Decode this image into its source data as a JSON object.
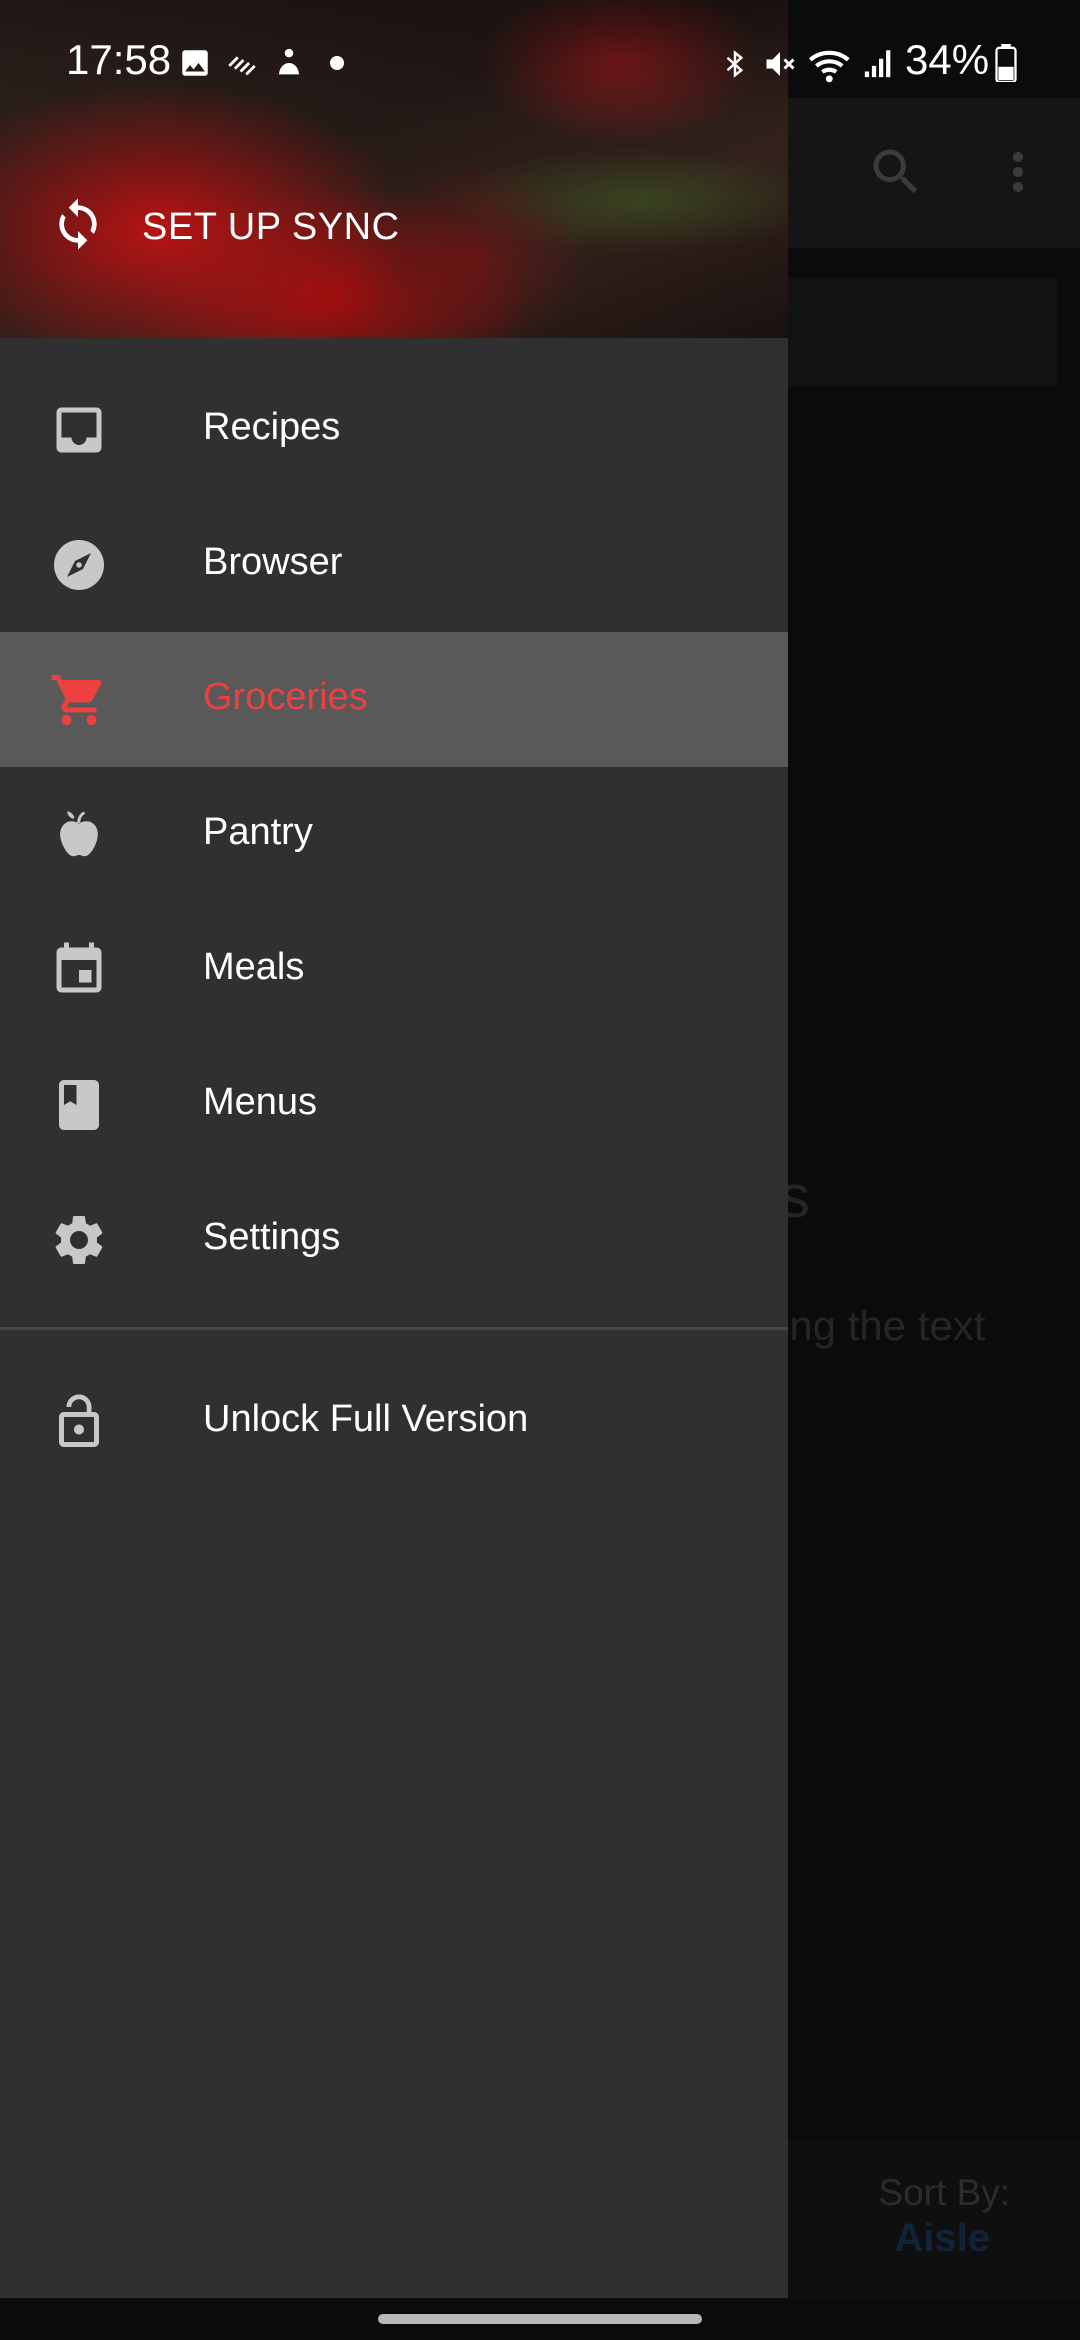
{
  "status_bar": {
    "time": "17:58",
    "battery": "34%",
    "left_icons": [
      "gallery-icon",
      "stripes-icon",
      "bixby-icon",
      "dot-icon"
    ],
    "right_icons": [
      "bluetooth-icon",
      "mute-icon",
      "wifi-icon",
      "signal-icon",
      "battery-icon"
    ]
  },
  "background_app": {
    "toolbar_icons": [
      "search-icon",
      "more-vert-icon"
    ],
    "empty_title_fragment": "s",
    "empty_subtitle_fragment": "ing the text",
    "sort_label": "Sort By:",
    "sort_value": "Aisle"
  },
  "drawer": {
    "header": {
      "sync_label": "SET UP SYNC"
    },
    "items": [
      {
        "label": "Recipes",
        "icon": "inbox-icon",
        "active": false
      },
      {
        "label": "Browser",
        "icon": "compass-icon",
        "active": false
      },
      {
        "label": "Groceries",
        "icon": "cart-icon",
        "active": true
      },
      {
        "label": "Pantry",
        "icon": "apple-icon",
        "active": false
      },
      {
        "label": "Meals",
        "icon": "calendar-icon",
        "active": false
      },
      {
        "label": "Menus",
        "icon": "book-icon",
        "active": false
      },
      {
        "label": "Settings",
        "icon": "gear-icon",
        "active": false
      }
    ],
    "unlock_label": "Unlock Full Version"
  },
  "colors": {
    "accent": "#ef4040",
    "drawer_bg": "#303030",
    "active_bg": "#595959",
    "sort_value": "#24476e"
  }
}
